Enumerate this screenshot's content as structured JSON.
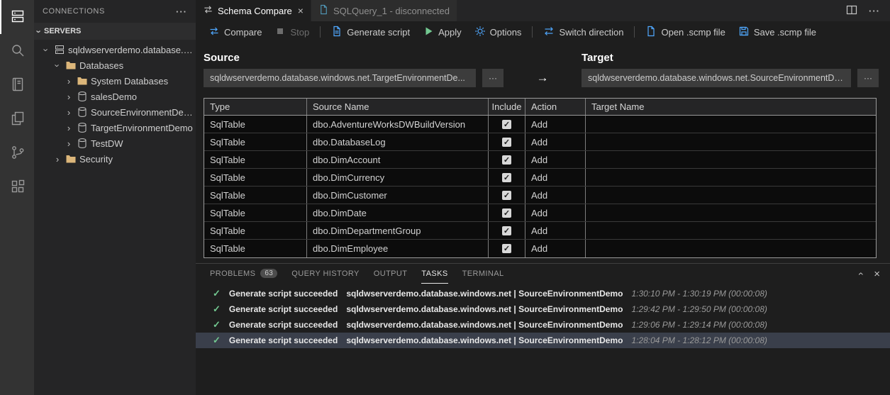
{
  "glyphs": {
    "chevron": "›",
    "close": "×",
    "more": "···",
    "check": "✓",
    "arrow_right": "→"
  },
  "colors": {
    "accent_blue": "#4fa8ff",
    "success_green": "#73c991",
    "folder_yellow": "#dcb67a"
  },
  "activity_bar": {
    "items": [
      {
        "name": "connections",
        "icon": "server-icon",
        "active": true
      },
      {
        "name": "search",
        "icon": "search-icon",
        "active": false
      },
      {
        "name": "notebooks",
        "icon": "book-icon",
        "active": false
      },
      {
        "name": "explorer",
        "icon": "pages-icon",
        "active": false
      },
      {
        "name": "source-control",
        "icon": "git-fork-icon",
        "active": false
      },
      {
        "name": "extensions",
        "icon": "extensions-icon",
        "active": false
      }
    ]
  },
  "sidebar": {
    "title": "CONNECTIONS",
    "section": "SERVERS",
    "tree": [
      {
        "label": "sqldwserverdemo.database.wi...",
        "icon": "server",
        "expanded": true,
        "level": 0
      },
      {
        "label": "Databases",
        "icon": "folder",
        "expanded": true,
        "level": 1
      },
      {
        "label": "System Databases",
        "icon": "folder",
        "expanded": false,
        "level": 2
      },
      {
        "label": "salesDemo",
        "icon": "database",
        "expanded": false,
        "level": 2
      },
      {
        "label": "SourceEnvironmentDemo",
        "icon": "database",
        "expanded": false,
        "level": 2
      },
      {
        "label": "TargetEnvironmentDemo",
        "icon": "database",
        "expanded": false,
        "level": 2
      },
      {
        "label": "TestDW",
        "icon": "database",
        "expanded": false,
        "level": 2
      },
      {
        "label": "Security",
        "icon": "folder",
        "expanded": false,
        "level": 1
      }
    ]
  },
  "editor": {
    "tabs": [
      {
        "label": "Schema Compare",
        "active": true
      },
      {
        "label": "SQLQuery_1 - disconnected",
        "active": false
      }
    ]
  },
  "toolbar": {
    "compare": "Compare",
    "stop": "Stop",
    "generate_script": "Generate script",
    "apply": "Apply",
    "options": "Options",
    "switch_direction": "Switch direction",
    "open_scmp": "Open .scmp file",
    "save_scmp": "Save .scmp file"
  },
  "compare": {
    "source_label": "Source",
    "target_label": "Target",
    "source_value": "sqldwserverdemo.database.windows.net.TargetEnvironmentDe...",
    "target_value": "sqldwserverdemo.database.windows.net.SourceEnvironmentDe..."
  },
  "grid": {
    "columns": [
      "Type",
      "Source Name",
      "Include",
      "Action",
      "Target Name"
    ],
    "rows": [
      {
        "type": "SqlTable",
        "source_name": "dbo.AdventureWorksDWBuildVersion",
        "include": true,
        "action": "Add",
        "target_name": ""
      },
      {
        "type": "SqlTable",
        "source_name": "dbo.DatabaseLog",
        "include": true,
        "action": "Add",
        "target_name": ""
      },
      {
        "type": "SqlTable",
        "source_name": "dbo.DimAccount",
        "include": true,
        "action": "Add",
        "target_name": ""
      },
      {
        "type": "SqlTable",
        "source_name": "dbo.DimCurrency",
        "include": true,
        "action": "Add",
        "target_name": ""
      },
      {
        "type": "SqlTable",
        "source_name": "dbo.DimCustomer",
        "include": true,
        "action": "Add",
        "target_name": ""
      },
      {
        "type": "SqlTable",
        "source_name": "dbo.DimDate",
        "include": true,
        "action": "Add",
        "target_name": ""
      },
      {
        "type": "SqlTable",
        "source_name": "dbo.DimDepartmentGroup",
        "include": true,
        "action": "Add",
        "target_name": ""
      },
      {
        "type": "SqlTable",
        "source_name": "dbo.DimEmployee",
        "include": true,
        "action": "Add",
        "target_name": ""
      }
    ]
  },
  "panel": {
    "tabs": [
      {
        "label": "PROBLEMS",
        "badge": "63",
        "active": false
      },
      {
        "label": "QUERY HISTORY",
        "active": false
      },
      {
        "label": "OUTPUT",
        "active": false
      },
      {
        "label": "TASKS",
        "active": true
      },
      {
        "label": "TERMINAL",
        "active": false
      }
    ],
    "tasks": [
      {
        "title": "Generate script succeeded",
        "detail": "sqldwserverdemo.database.windows.net | SourceEnvironmentDemo",
        "time": "1:30:10 PM - 1:30:19 PM (00:00:08)"
      },
      {
        "title": "Generate script succeeded",
        "detail": "sqldwserverdemo.database.windows.net | SourceEnvironmentDemo",
        "time": "1:29:42 PM - 1:29:50 PM (00:00:08)"
      },
      {
        "title": "Generate script succeeded",
        "detail": "sqldwserverdemo.database.windows.net | SourceEnvironmentDemo",
        "time": "1:29:06 PM - 1:29:14 PM (00:00:08)"
      },
      {
        "title": "Generate script succeeded",
        "detail": "sqldwserverdemo.database.windows.net | SourceEnvironmentDemo",
        "time": "1:28:04 PM - 1:28:12 PM (00:00:08)",
        "selected": true
      }
    ]
  }
}
